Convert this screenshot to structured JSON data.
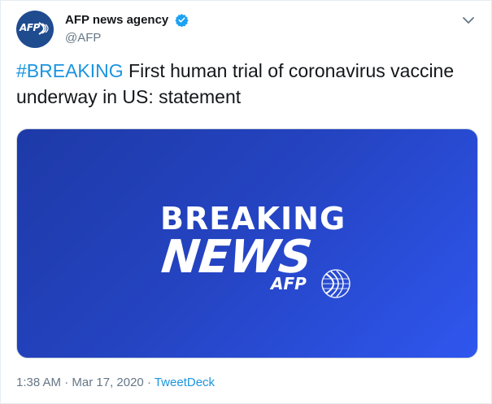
{
  "account": {
    "display_name": "AFP news agency",
    "handle": "@AFP",
    "avatar_text": "AFP",
    "verified": true
  },
  "tweet": {
    "hashtag": "#BREAKING",
    "text": " First human trial of coronavirus vaccine underway in US: statement"
  },
  "media": {
    "line1": "BREAKING",
    "line2": "NEWS",
    "brand": "AFP"
  },
  "meta": {
    "time": "1:38 AM",
    "separator1": " · ",
    "date": "Mar 17, 2020",
    "separator2": " · ",
    "source": "TweetDeck"
  },
  "colors": {
    "link": "#1b95e0",
    "secondary_text": "#657786",
    "media_gradient_start": "#1e3aa8",
    "media_gradient_end": "#2f56ee",
    "avatar_bg": "#1f4b8f"
  },
  "icons": {
    "verified": "verified-badge-icon",
    "menu": "chevron-down-icon",
    "globe": "afp-globe-icon"
  }
}
